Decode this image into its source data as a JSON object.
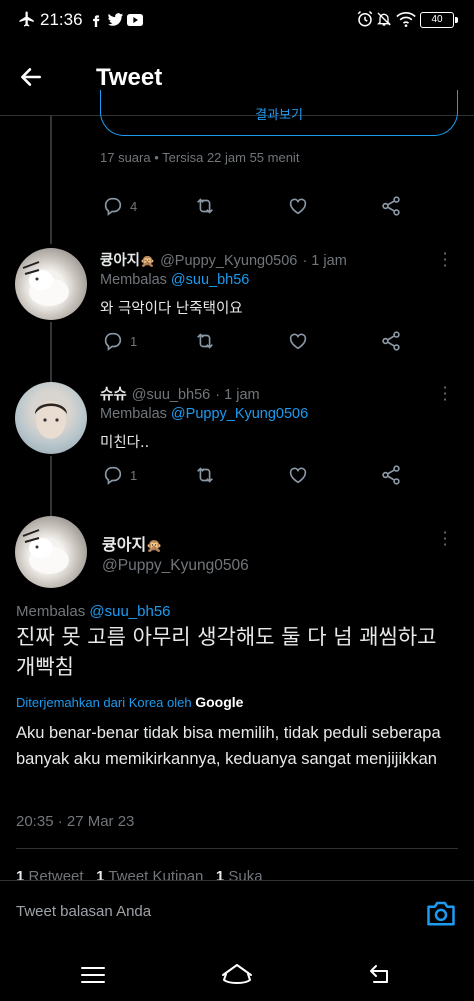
{
  "status_bar": {
    "time": "21:36",
    "battery": "40"
  },
  "header": {
    "title": "Tweet"
  },
  "poll": {
    "button_label": "결과보기",
    "votes": "17 suara",
    "remaining": "Tersisa 22 jam 55 menit"
  },
  "parent_actions": {
    "reply_count": "4"
  },
  "replies": [
    {
      "name": "큥아지",
      "handle": "@Puppy_Kyung0506",
      "time": "· 1 jam",
      "replying_label": "Membalas",
      "replying_to": "@suu_bh56",
      "text": "와 극악이다 난죽택이요",
      "reply_count": "1"
    },
    {
      "name": "슈슈",
      "handle": "@suu_bh56",
      "time": "· 1 jam",
      "replying_label": "Membalas",
      "replying_to": "@Puppy_Kyung0506",
      "text": "미친다..",
      "reply_count": "1"
    }
  ],
  "main_tweet": {
    "name": "큥아지",
    "handle": "@Puppy_Kyung0506",
    "replying_label": "Membalas",
    "replying_to": "@suu_bh56",
    "text": "진짜 못 고름 아무리 생각해도 둘 다 넘 괘씸하고 개빡침",
    "translated_by": "Diterjemahkan dari Korea oleh",
    "translator": "Google",
    "translation": "Aku benar-benar tidak bisa memilih, tidak peduli seberapa banyak aku memikirkannya, keduanya sangat menjijikkan",
    "timestamp": "20:35 · 27 Mar 23",
    "stats": {
      "retweets_count": "1",
      "retweets_label": "Retweet",
      "quotes_count": "1",
      "quotes_label": "Tweet Kutipan",
      "likes_count": "1",
      "likes_label": "Suka"
    }
  },
  "reply_bar": {
    "placeholder": "Tweet balasan Anda"
  },
  "colors": {
    "accent": "#1d9bf0",
    "muted": "#71767b",
    "text": "#e7e9ea",
    "background": "#000000"
  }
}
